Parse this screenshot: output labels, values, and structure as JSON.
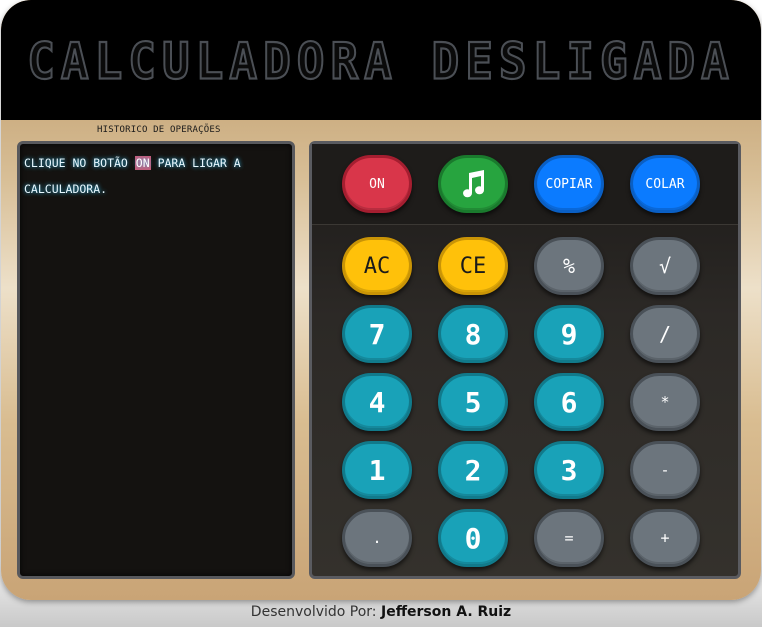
{
  "display": {
    "text": "CALCULADORA DESLIGADA"
  },
  "history": {
    "title": "HISTORICO DE OPERAÇÕES",
    "message_pre": "CLIQUE NO BOTÃO ",
    "message_highlight": "ON",
    "message_post": " PARA LIGAR A CALCULADORA."
  },
  "keys": {
    "on": "ON",
    "music_icon": "music-note-icon",
    "copy": "COPIAR",
    "paste": "COLAR",
    "ac": "AC",
    "ce": "CE",
    "percent": "%",
    "sqrt": "√",
    "seven": "7",
    "eight": "8",
    "nine": "9",
    "divide": "/",
    "four": "4",
    "five": "5",
    "six": "6",
    "multiply": "*",
    "one": "1",
    "two": "2",
    "three": "3",
    "minus": "-",
    "dot": ".",
    "zero": "0",
    "equals": "=",
    "plus": "+"
  },
  "footer": {
    "prefix": "Desenvolvido Por: ",
    "author": "Jefferson A. Ruiz"
  },
  "colors": {
    "on": "#d9364a",
    "music": "#27a43f",
    "copy_paste": "#0b7bff",
    "ac_ce": "#ffc10a",
    "operators": "#6c757d",
    "digits": "#19a2b8",
    "history_text_glow": "#35c8ff"
  }
}
